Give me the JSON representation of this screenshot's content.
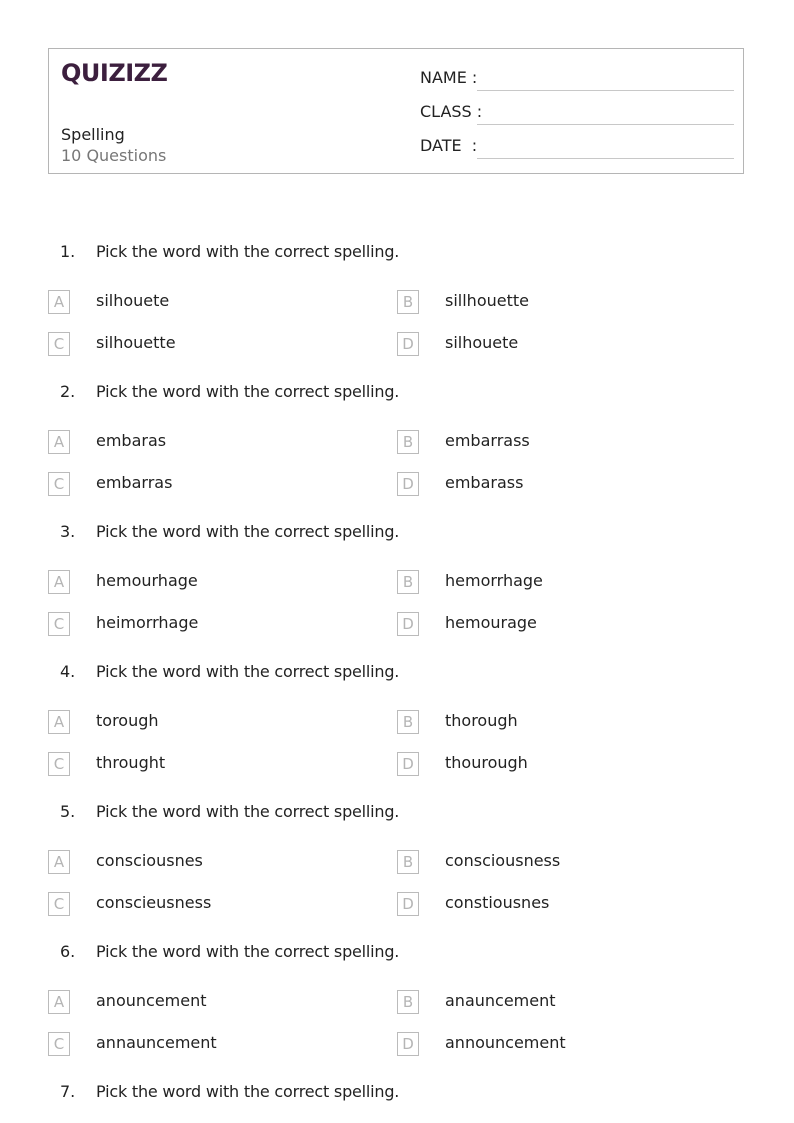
{
  "header": {
    "logo": "QUIZIZZ",
    "title": "Spelling",
    "subtitle": "10 Questions",
    "fields": [
      {
        "label": "NAME :"
      },
      {
        "label": "CLASS :"
      },
      {
        "label": "DATE  :"
      }
    ]
  },
  "questions": [
    {
      "number": "1.",
      "text": "Pick the word with the correct spelling.",
      "options": [
        {
          "letter": "A",
          "text": "silhouete"
        },
        {
          "letter": "B",
          "text": "sillhouette"
        },
        {
          "letter": "C",
          "text": "silhouette"
        },
        {
          "letter": "D",
          "text": "silhouete"
        }
      ]
    },
    {
      "number": "2.",
      "text": "Pick the word with the correct spelling.",
      "options": [
        {
          "letter": "A",
          "text": "embaras"
        },
        {
          "letter": "B",
          "text": "embarrass"
        },
        {
          "letter": "C",
          "text": "embarras"
        },
        {
          "letter": "D",
          "text": "embarass"
        }
      ]
    },
    {
      "number": "3.",
      "text": "Pick the word with the correct spelling.",
      "options": [
        {
          "letter": "A",
          "text": "hemourhage"
        },
        {
          "letter": "B",
          "text": "hemorrhage"
        },
        {
          "letter": "C",
          "text": "heimorrhage"
        },
        {
          "letter": "D",
          "text": "hemourage"
        }
      ]
    },
    {
      "number": "4.",
      "text": "Pick the word with the correct spelling.",
      "options": [
        {
          "letter": "A",
          "text": "torough"
        },
        {
          "letter": "B",
          "text": "thorough"
        },
        {
          "letter": "C",
          "text": "throught"
        },
        {
          "letter": "D",
          "text": "thourough"
        }
      ]
    },
    {
      "number": "5.",
      "text": "Pick the word with the correct spelling.",
      "options": [
        {
          "letter": "A",
          "text": "consciousnes"
        },
        {
          "letter": "B",
          "text": "consciousness"
        },
        {
          "letter": "C",
          "text": "conscieusness"
        },
        {
          "letter": "D",
          "text": "constiousnes"
        }
      ]
    },
    {
      "number": "6.",
      "text": "Pick the word with the correct spelling.",
      "options": [
        {
          "letter": "A",
          "text": "anouncement"
        },
        {
          "letter": "B",
          "text": "anauncement"
        },
        {
          "letter": "C",
          "text": "annauncement"
        },
        {
          "letter": "D",
          "text": "announcement"
        }
      ]
    },
    {
      "number": "7.",
      "text": "Pick the word with the correct spelling.",
      "options": []
    }
  ]
}
